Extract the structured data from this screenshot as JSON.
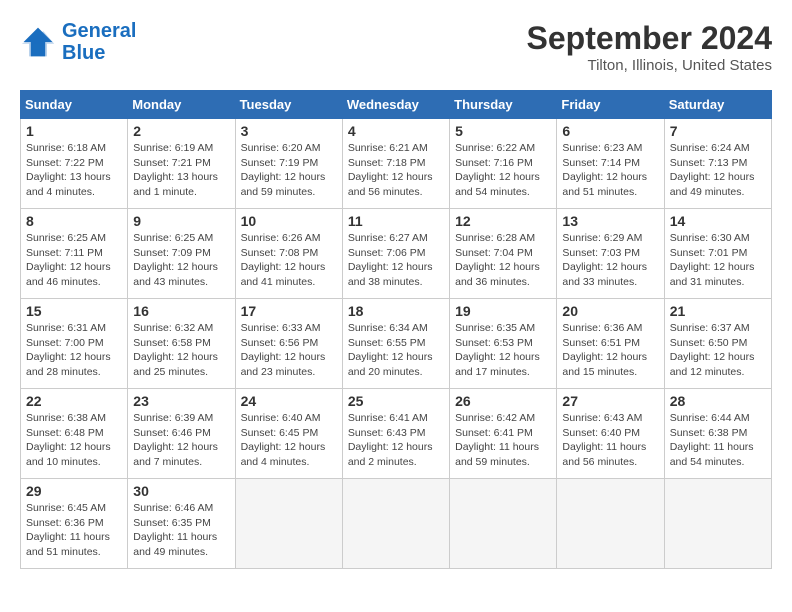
{
  "header": {
    "logo_line1": "General",
    "logo_line2": "Blue",
    "month": "September 2024",
    "location": "Tilton, Illinois, United States"
  },
  "weekdays": [
    "Sunday",
    "Monday",
    "Tuesday",
    "Wednesday",
    "Thursday",
    "Friday",
    "Saturday"
  ],
  "weeks": [
    [
      {
        "day": "1",
        "info": "Sunrise: 6:18 AM\nSunset: 7:22 PM\nDaylight: 13 hours\nand 4 minutes."
      },
      {
        "day": "2",
        "info": "Sunrise: 6:19 AM\nSunset: 7:21 PM\nDaylight: 13 hours\nand 1 minute."
      },
      {
        "day": "3",
        "info": "Sunrise: 6:20 AM\nSunset: 7:19 PM\nDaylight: 12 hours\nand 59 minutes."
      },
      {
        "day": "4",
        "info": "Sunrise: 6:21 AM\nSunset: 7:18 PM\nDaylight: 12 hours\nand 56 minutes."
      },
      {
        "day": "5",
        "info": "Sunrise: 6:22 AM\nSunset: 7:16 PM\nDaylight: 12 hours\nand 54 minutes."
      },
      {
        "day": "6",
        "info": "Sunrise: 6:23 AM\nSunset: 7:14 PM\nDaylight: 12 hours\nand 51 minutes."
      },
      {
        "day": "7",
        "info": "Sunrise: 6:24 AM\nSunset: 7:13 PM\nDaylight: 12 hours\nand 49 minutes."
      }
    ],
    [
      {
        "day": "8",
        "info": "Sunrise: 6:25 AM\nSunset: 7:11 PM\nDaylight: 12 hours\nand 46 minutes."
      },
      {
        "day": "9",
        "info": "Sunrise: 6:25 AM\nSunset: 7:09 PM\nDaylight: 12 hours\nand 43 minutes."
      },
      {
        "day": "10",
        "info": "Sunrise: 6:26 AM\nSunset: 7:08 PM\nDaylight: 12 hours\nand 41 minutes."
      },
      {
        "day": "11",
        "info": "Sunrise: 6:27 AM\nSunset: 7:06 PM\nDaylight: 12 hours\nand 38 minutes."
      },
      {
        "day": "12",
        "info": "Sunrise: 6:28 AM\nSunset: 7:04 PM\nDaylight: 12 hours\nand 36 minutes."
      },
      {
        "day": "13",
        "info": "Sunrise: 6:29 AM\nSunset: 7:03 PM\nDaylight: 12 hours\nand 33 minutes."
      },
      {
        "day": "14",
        "info": "Sunrise: 6:30 AM\nSunset: 7:01 PM\nDaylight: 12 hours\nand 31 minutes."
      }
    ],
    [
      {
        "day": "15",
        "info": "Sunrise: 6:31 AM\nSunset: 7:00 PM\nDaylight: 12 hours\nand 28 minutes."
      },
      {
        "day": "16",
        "info": "Sunrise: 6:32 AM\nSunset: 6:58 PM\nDaylight: 12 hours\nand 25 minutes."
      },
      {
        "day": "17",
        "info": "Sunrise: 6:33 AM\nSunset: 6:56 PM\nDaylight: 12 hours\nand 23 minutes."
      },
      {
        "day": "18",
        "info": "Sunrise: 6:34 AM\nSunset: 6:55 PM\nDaylight: 12 hours\nand 20 minutes."
      },
      {
        "day": "19",
        "info": "Sunrise: 6:35 AM\nSunset: 6:53 PM\nDaylight: 12 hours\nand 17 minutes."
      },
      {
        "day": "20",
        "info": "Sunrise: 6:36 AM\nSunset: 6:51 PM\nDaylight: 12 hours\nand 15 minutes."
      },
      {
        "day": "21",
        "info": "Sunrise: 6:37 AM\nSunset: 6:50 PM\nDaylight: 12 hours\nand 12 minutes."
      }
    ],
    [
      {
        "day": "22",
        "info": "Sunrise: 6:38 AM\nSunset: 6:48 PM\nDaylight: 12 hours\nand 10 minutes."
      },
      {
        "day": "23",
        "info": "Sunrise: 6:39 AM\nSunset: 6:46 PM\nDaylight: 12 hours\nand 7 minutes."
      },
      {
        "day": "24",
        "info": "Sunrise: 6:40 AM\nSunset: 6:45 PM\nDaylight: 12 hours\nand 4 minutes."
      },
      {
        "day": "25",
        "info": "Sunrise: 6:41 AM\nSunset: 6:43 PM\nDaylight: 12 hours\nand 2 minutes."
      },
      {
        "day": "26",
        "info": "Sunrise: 6:42 AM\nSunset: 6:41 PM\nDaylight: 11 hours\nand 59 minutes."
      },
      {
        "day": "27",
        "info": "Sunrise: 6:43 AM\nSunset: 6:40 PM\nDaylight: 11 hours\nand 56 minutes."
      },
      {
        "day": "28",
        "info": "Sunrise: 6:44 AM\nSunset: 6:38 PM\nDaylight: 11 hours\nand 54 minutes."
      }
    ],
    [
      {
        "day": "29",
        "info": "Sunrise: 6:45 AM\nSunset: 6:36 PM\nDaylight: 11 hours\nand 51 minutes."
      },
      {
        "day": "30",
        "info": "Sunrise: 6:46 AM\nSunset: 6:35 PM\nDaylight: 11 hours\nand 49 minutes."
      },
      {
        "day": "",
        "info": ""
      },
      {
        "day": "",
        "info": ""
      },
      {
        "day": "",
        "info": ""
      },
      {
        "day": "",
        "info": ""
      },
      {
        "day": "",
        "info": ""
      }
    ]
  ]
}
